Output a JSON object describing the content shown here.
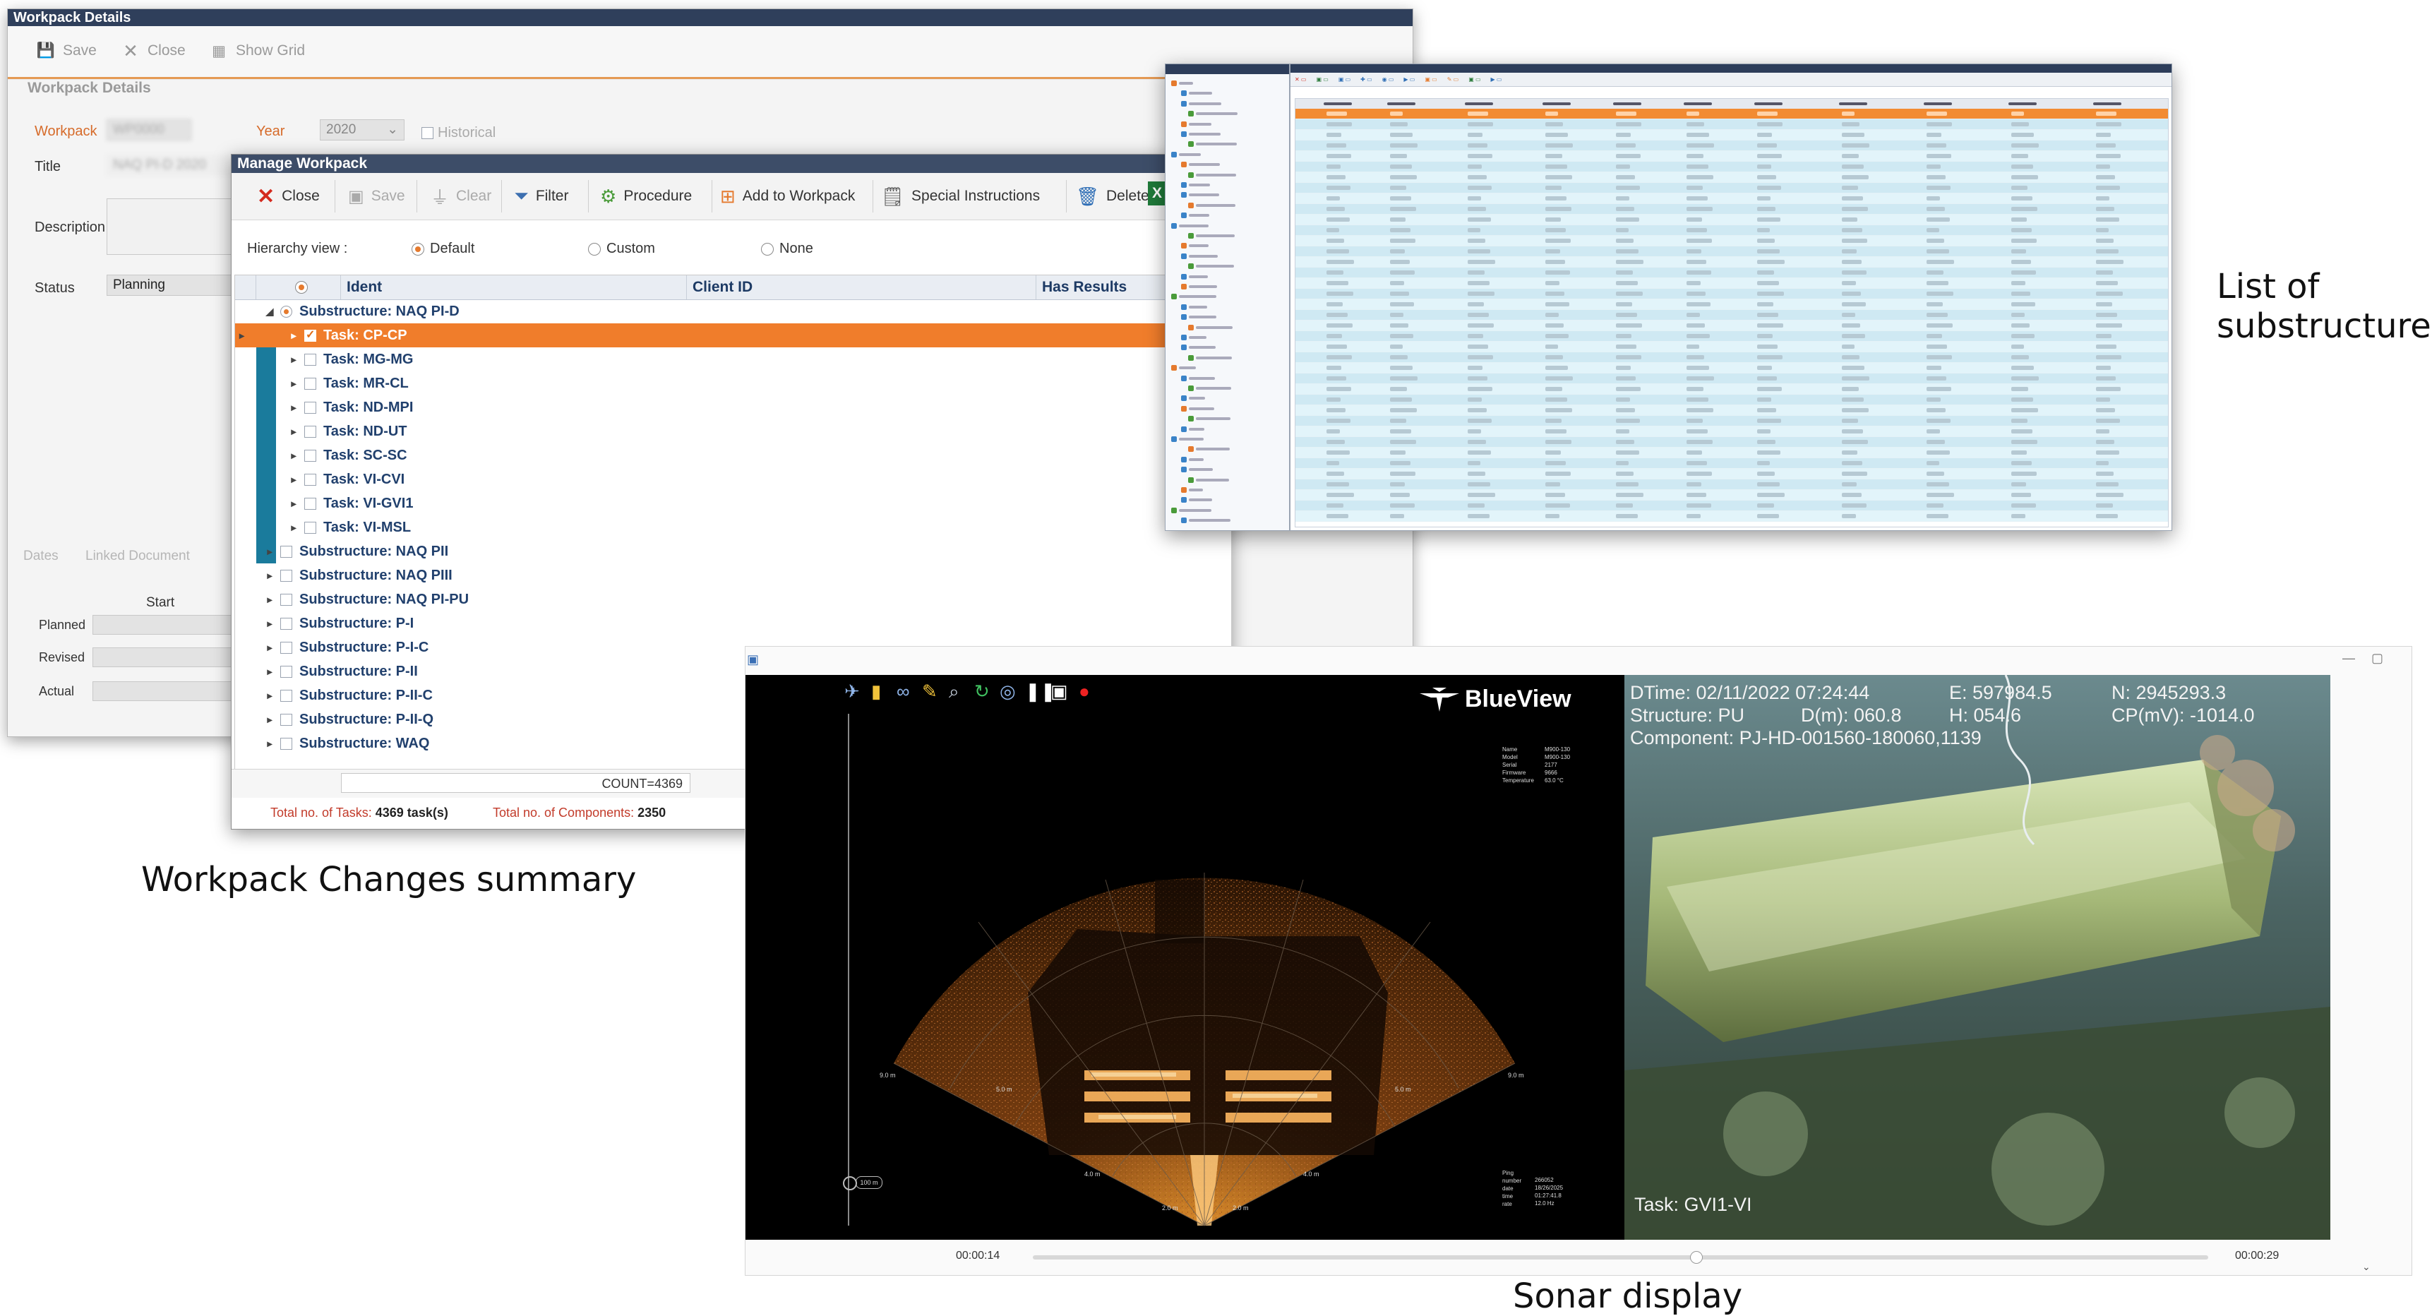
{
  "workpack_details": {
    "title": "Workpack Details",
    "toolbar": {
      "save": "Save",
      "close": "Close",
      "show_grid": "Show Grid"
    },
    "section_title": "Workpack Details",
    "labels": {
      "workpack": "Workpack",
      "year": "Year",
      "title": "Title",
      "description": "Description",
      "status": "Status"
    },
    "values": {
      "year": "2020",
      "status": "Planning",
      "historical": "Historical"
    },
    "tabs": {
      "dates": "Dates",
      "linked_document": "Linked Document"
    },
    "dates": {
      "start_header": "Start",
      "planned": "Planned",
      "revised": "Revised",
      "actual": "Actual"
    }
  },
  "manage_workpack": {
    "title": "Manage Workpack",
    "toolbar": {
      "close": "Close",
      "save": "Save",
      "clear": "Clear",
      "filter": "Filter",
      "procedure": "Procedure",
      "add_to_workpack": "Add to Workpack",
      "special_instructions": "Special Instructions",
      "delete": "Delete"
    },
    "hierarchy": {
      "label": "Hierarchy view :",
      "default": "Default",
      "custom": "Custom",
      "none": "None"
    },
    "columns": {
      "ident": "Ident",
      "client_id": "Client ID",
      "has_results": "Has Results"
    },
    "rows": [
      {
        "label": "Substructure: NAQ PI-D",
        "level": 0
      },
      {
        "label": "Task: CP-CP",
        "level": 1,
        "selected": true
      },
      {
        "label": "Task: MG-MG",
        "level": 1
      },
      {
        "label": "Task: MR-CL",
        "level": 1
      },
      {
        "label": "Task: ND-MPI",
        "level": 1
      },
      {
        "label": "Task: ND-UT",
        "level": 1
      },
      {
        "label": "Task: SC-SC",
        "level": 1
      },
      {
        "label": "Task: VI-CVI",
        "level": 1
      },
      {
        "label": "Task: VI-GVI1",
        "level": 1
      },
      {
        "label": "Task: VI-MSL",
        "level": 1
      },
      {
        "label": "Substructure: NAQ PII",
        "level": 0
      },
      {
        "label": "Substructure: NAQ PIII",
        "level": 0
      },
      {
        "label": "Substructure: NAQ PI-PU",
        "level": 0
      },
      {
        "label": "Substructure: P-I",
        "level": 0
      },
      {
        "label": "Substructure: P-I-C",
        "level": 0
      },
      {
        "label": "Substructure: P-II",
        "level": 0
      },
      {
        "label": "Substructure: P-II-C",
        "level": 0
      },
      {
        "label": "Substructure: P-II-Q",
        "level": 0
      },
      {
        "label": "Substructure: WAQ",
        "level": 0
      }
    ],
    "count": "COUNT=4369",
    "totals": {
      "tasks_label": "Total no. of Tasks:",
      "tasks_value": "4369 task(s)",
      "components_label": "Total no. of Components:",
      "components_value": "2350"
    }
  },
  "sonar": {
    "brand": "BlueView",
    "overlay": {
      "dtime": "DTime: 02/11/2022 07:24:44",
      "e": "E: 597984.5",
      "n": "N: 2945293.3",
      "structure": "Structure: PU",
      "d": "D(m): 060.8",
      "h": "H: 054.6",
      "cp": "CP(mV): -1014.0",
      "component": "Component: PJ-HD-001560-180060,1139",
      "task": "Task: GVI1-VI"
    },
    "time_start": "00:00:14",
    "time_end": "00:00:29"
  },
  "captions": {
    "workpack": "Workpack Changes summary",
    "list": "List of substructure",
    "sonar": "Sonar display"
  },
  "colors": {
    "accent": "#f07d2b",
    "navy": "#2f3f5b",
    "teal": "#1a7b9c"
  }
}
